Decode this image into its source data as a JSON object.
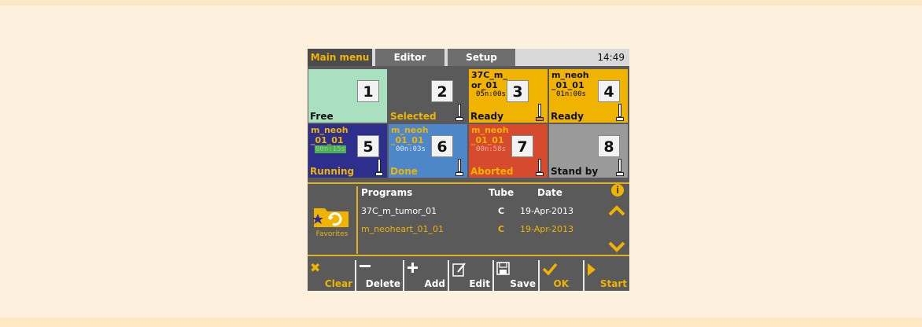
{
  "tabs": [
    {
      "label": "Main menu",
      "active": true
    },
    {
      "label": "Editor",
      "active": false
    },
    {
      "label": "Setup",
      "active": false
    }
  ],
  "clock": "14:49",
  "slots": [
    {
      "num": "1",
      "status": "Free",
      "bg": "#a8e0c0",
      "status_color": "#111111",
      "tube": false
    },
    {
      "num": "2",
      "status": "Selected",
      "bg": "#5a5a5a",
      "status_color": "#f0b400",
      "tube": true
    },
    {
      "num": "3",
      "prog1": "37C_m_",
      "prog2": "or_01",
      "time": "05n:00s",
      "status": "Ready",
      "bg": "#f0b400",
      "status_color": "#111111",
      "tube": true
    },
    {
      "num": "4",
      "prog1": "m_neoh",
      "prog2": "_01_01",
      "time": "01n:00s",
      "status": "Ready",
      "bg": "#f0b400",
      "status_color": "#111111",
      "tube": true
    },
    {
      "num": "5",
      "prog1": "m_neoh",
      "prog2": "_01_01",
      "time": "00n:15s",
      "status": "Running",
      "bg": "#2e2f8c",
      "status_color": "#f0b400",
      "tube": true
    },
    {
      "num": "6",
      "prog1": "m_neoh",
      "prog2": "_01_01",
      "time": "00n:03s",
      "status": "Done",
      "bg": "#4d86c9",
      "status_color": "#f0b400",
      "tube": true
    },
    {
      "num": "7",
      "prog1": "m_neoh",
      "prog2": "_01_01",
      "time": "00n:58s",
      "status": "Aborted",
      "bg": "#d64a2e",
      "status_color": "#f0b400",
      "tube": true
    },
    {
      "num": "8",
      "status": "Stand by",
      "bg": "#9a9a9a",
      "status_color": "#111111",
      "tube": true
    }
  ],
  "favorites_label": "Favorites",
  "list": {
    "headers": {
      "programs": "Programs",
      "tube": "Tube",
      "date": "Date"
    },
    "rows": [
      {
        "program": "37C_m_tumor_01",
        "tube": "C",
        "date": "19-Apr-2013",
        "color": "#ffffff"
      },
      {
        "program": "m_neoheart_01_01",
        "tube": "C",
        "date": "19-Apr-2013",
        "color": "#f0b400"
      }
    ]
  },
  "info_icon": "i",
  "toolbar": [
    {
      "label": "Clear",
      "icon": "x-icon"
    },
    {
      "label": "Delete",
      "icon": "minus-icon"
    },
    {
      "label": "Add",
      "icon": "plus-icon"
    },
    {
      "label": "Edit",
      "icon": "edit-icon"
    },
    {
      "label": "Save",
      "icon": "save-icon"
    },
    {
      "label": "OK",
      "icon": "check-icon"
    },
    {
      "label": "Start",
      "icon": "play-icon"
    }
  ],
  "colors": {
    "accent": "#f0b400",
    "panel": "#5a5a5a",
    "background": "#fdf0dc"
  }
}
